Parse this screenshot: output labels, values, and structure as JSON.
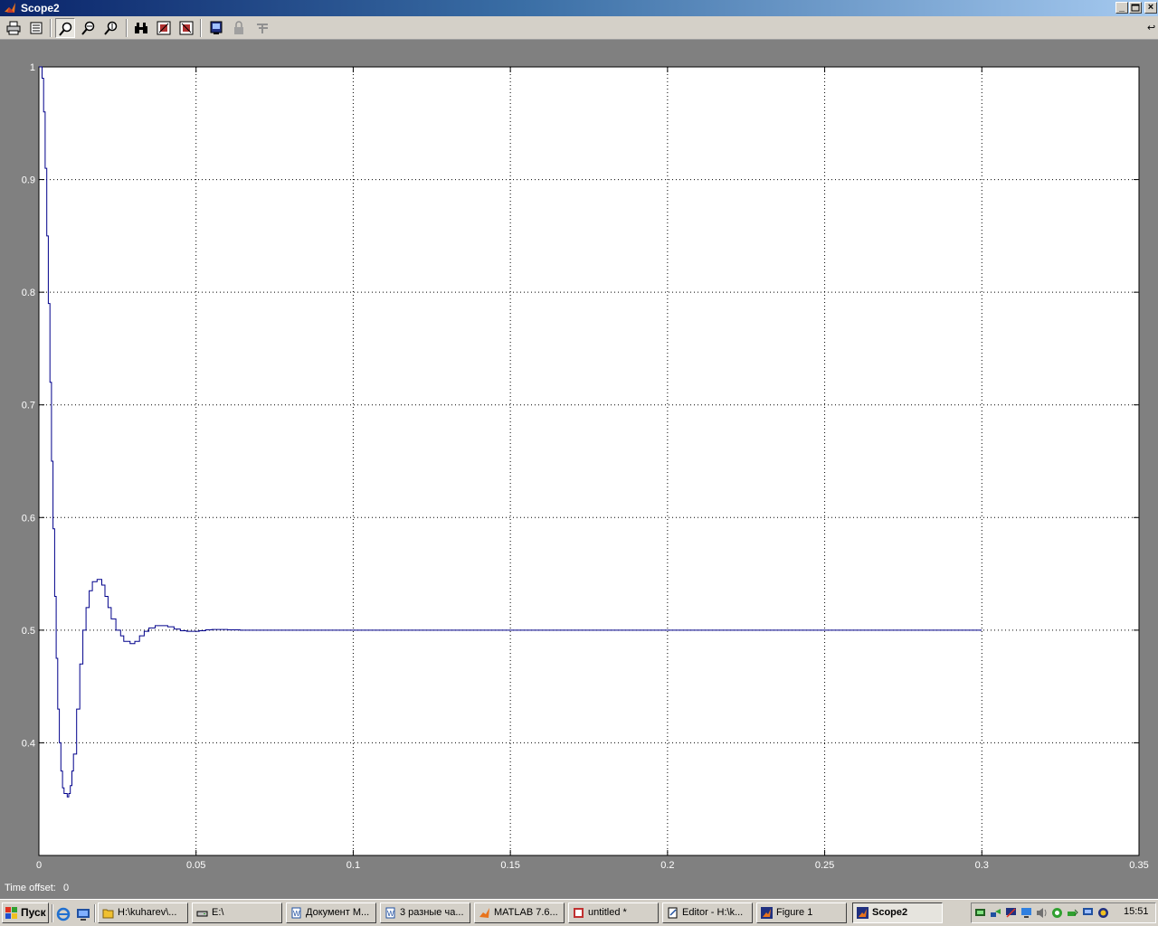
{
  "window": {
    "title": "Scope2"
  },
  "toolbar": {
    "buttons": [
      {
        "name": "print-button",
        "icon": "printer-icon"
      },
      {
        "name": "parameters-button",
        "icon": "parameters-icon"
      },
      {
        "name": "zoom-button",
        "icon": "magnifier-icon",
        "pressed": true
      },
      {
        "name": "zoom-x-button",
        "icon": "zoom-x-icon"
      },
      {
        "name": "zoom-y-button",
        "icon": "zoom-y-icon"
      },
      {
        "name": "autoscale-button",
        "icon": "binoculars-icon"
      },
      {
        "name": "save-axes-button",
        "icon": "save-axes-icon"
      },
      {
        "name": "restore-axes-button",
        "icon": "restore-axes-icon"
      },
      {
        "name": "floating-scope-button",
        "icon": "floating-scope-icon"
      },
      {
        "name": "lock-axes-button",
        "icon": "lock-icon",
        "disabled": true
      },
      {
        "name": "signal-selection-button",
        "icon": "signal-selection-icon",
        "disabled": true
      }
    ]
  },
  "status": {
    "time_offset_label": "Time offset:",
    "time_offset_value": "0"
  },
  "chart_data": {
    "type": "line",
    "title": "",
    "xlabel": "",
    "ylabel": "",
    "xlim": [
      0,
      0.35
    ],
    "ylim": [
      0.3,
      1.0
    ],
    "xticks": [
      "0",
      "0.05",
      "0.1",
      "0.15",
      "0.2",
      "0.25",
      "0.3",
      "0.35"
    ],
    "yticks": [
      "0.4",
      "0.5",
      "0.6",
      "0.7",
      "0.8",
      "0.9",
      "1"
    ],
    "grid": true,
    "colors": {
      "background": "#ffffff",
      "line": "#00008b",
      "grid": "#000000",
      "frame": "#808080"
    },
    "series": [
      {
        "points": [
          [
            0,
            1.0
          ],
          [
            0.0005,
            1.0
          ],
          [
            0.001,
            0.99
          ],
          [
            0.0015,
            0.96
          ],
          [
            0.002,
            0.91
          ],
          [
            0.0025,
            0.85
          ],
          [
            0.003,
            0.79
          ],
          [
            0.0035,
            0.72
          ],
          [
            0.004,
            0.65
          ],
          [
            0.0045,
            0.59
          ],
          [
            0.005,
            0.53
          ],
          [
            0.0055,
            0.475
          ],
          [
            0.006,
            0.43
          ],
          [
            0.0065,
            0.4
          ],
          [
            0.007,
            0.375
          ],
          [
            0.0075,
            0.36
          ],
          [
            0.008,
            0.355
          ],
          [
            0.009,
            0.352
          ],
          [
            0.0095,
            0.355
          ],
          [
            0.01,
            0.362
          ],
          [
            0.0105,
            0.375
          ],
          [
            0.011,
            0.39
          ],
          [
            0.012,
            0.43
          ],
          [
            0.013,
            0.47
          ],
          [
            0.014,
            0.5
          ],
          [
            0.015,
            0.52
          ],
          [
            0.016,
            0.535
          ],
          [
            0.017,
            0.543
          ],
          [
            0.0185,
            0.545
          ],
          [
            0.02,
            0.54
          ],
          [
            0.021,
            0.53
          ],
          [
            0.022,
            0.52
          ],
          [
            0.023,
            0.51
          ],
          [
            0.0245,
            0.5
          ],
          [
            0.026,
            0.495
          ],
          [
            0.027,
            0.49
          ],
          [
            0.029,
            0.488
          ],
          [
            0.0305,
            0.49
          ],
          [
            0.032,
            0.495
          ],
          [
            0.0335,
            0.499
          ],
          [
            0.035,
            0.502
          ],
          [
            0.037,
            0.504
          ],
          [
            0.039,
            0.504
          ],
          [
            0.041,
            0.503
          ],
          [
            0.043,
            0.501
          ],
          [
            0.045,
            0.4995
          ],
          [
            0.047,
            0.499
          ],
          [
            0.049,
            0.499
          ],
          [
            0.051,
            0.4995
          ],
          [
            0.053,
            0.5003
          ],
          [
            0.055,
            0.5006
          ],
          [
            0.057,
            0.5006
          ],
          [
            0.06,
            0.5003
          ],
          [
            0.064,
            0.5
          ],
          [
            0.08,
            0.5
          ],
          [
            0.3,
            0.5
          ]
        ]
      }
    ]
  },
  "taskbar": {
    "start_label": "Пуск",
    "tasks": [
      {
        "label": "H:\\kuharev\\...",
        "icon": "folder-icon",
        "active": false
      },
      {
        "label": "E:\\",
        "icon": "drive-icon",
        "active": false
      },
      {
        "label": "Документ М...",
        "icon": "word-icon",
        "active": false
      },
      {
        "label": "3 разные ча...",
        "icon": "word-icon",
        "active": false
      },
      {
        "label": "MATLAB 7.6...",
        "icon": "matlab-icon",
        "active": false
      },
      {
        "label": "untitled *",
        "icon": "simulink-icon",
        "active": false
      },
      {
        "label": "Editor - H:\\k...",
        "icon": "editor-icon",
        "active": false
      },
      {
        "label": "Figure 1",
        "icon": "matlab-figure-icon",
        "active": false
      },
      {
        "label": "Scope2",
        "icon": "matlab-figure-icon",
        "active": true
      }
    ],
    "clock": "15:51"
  }
}
